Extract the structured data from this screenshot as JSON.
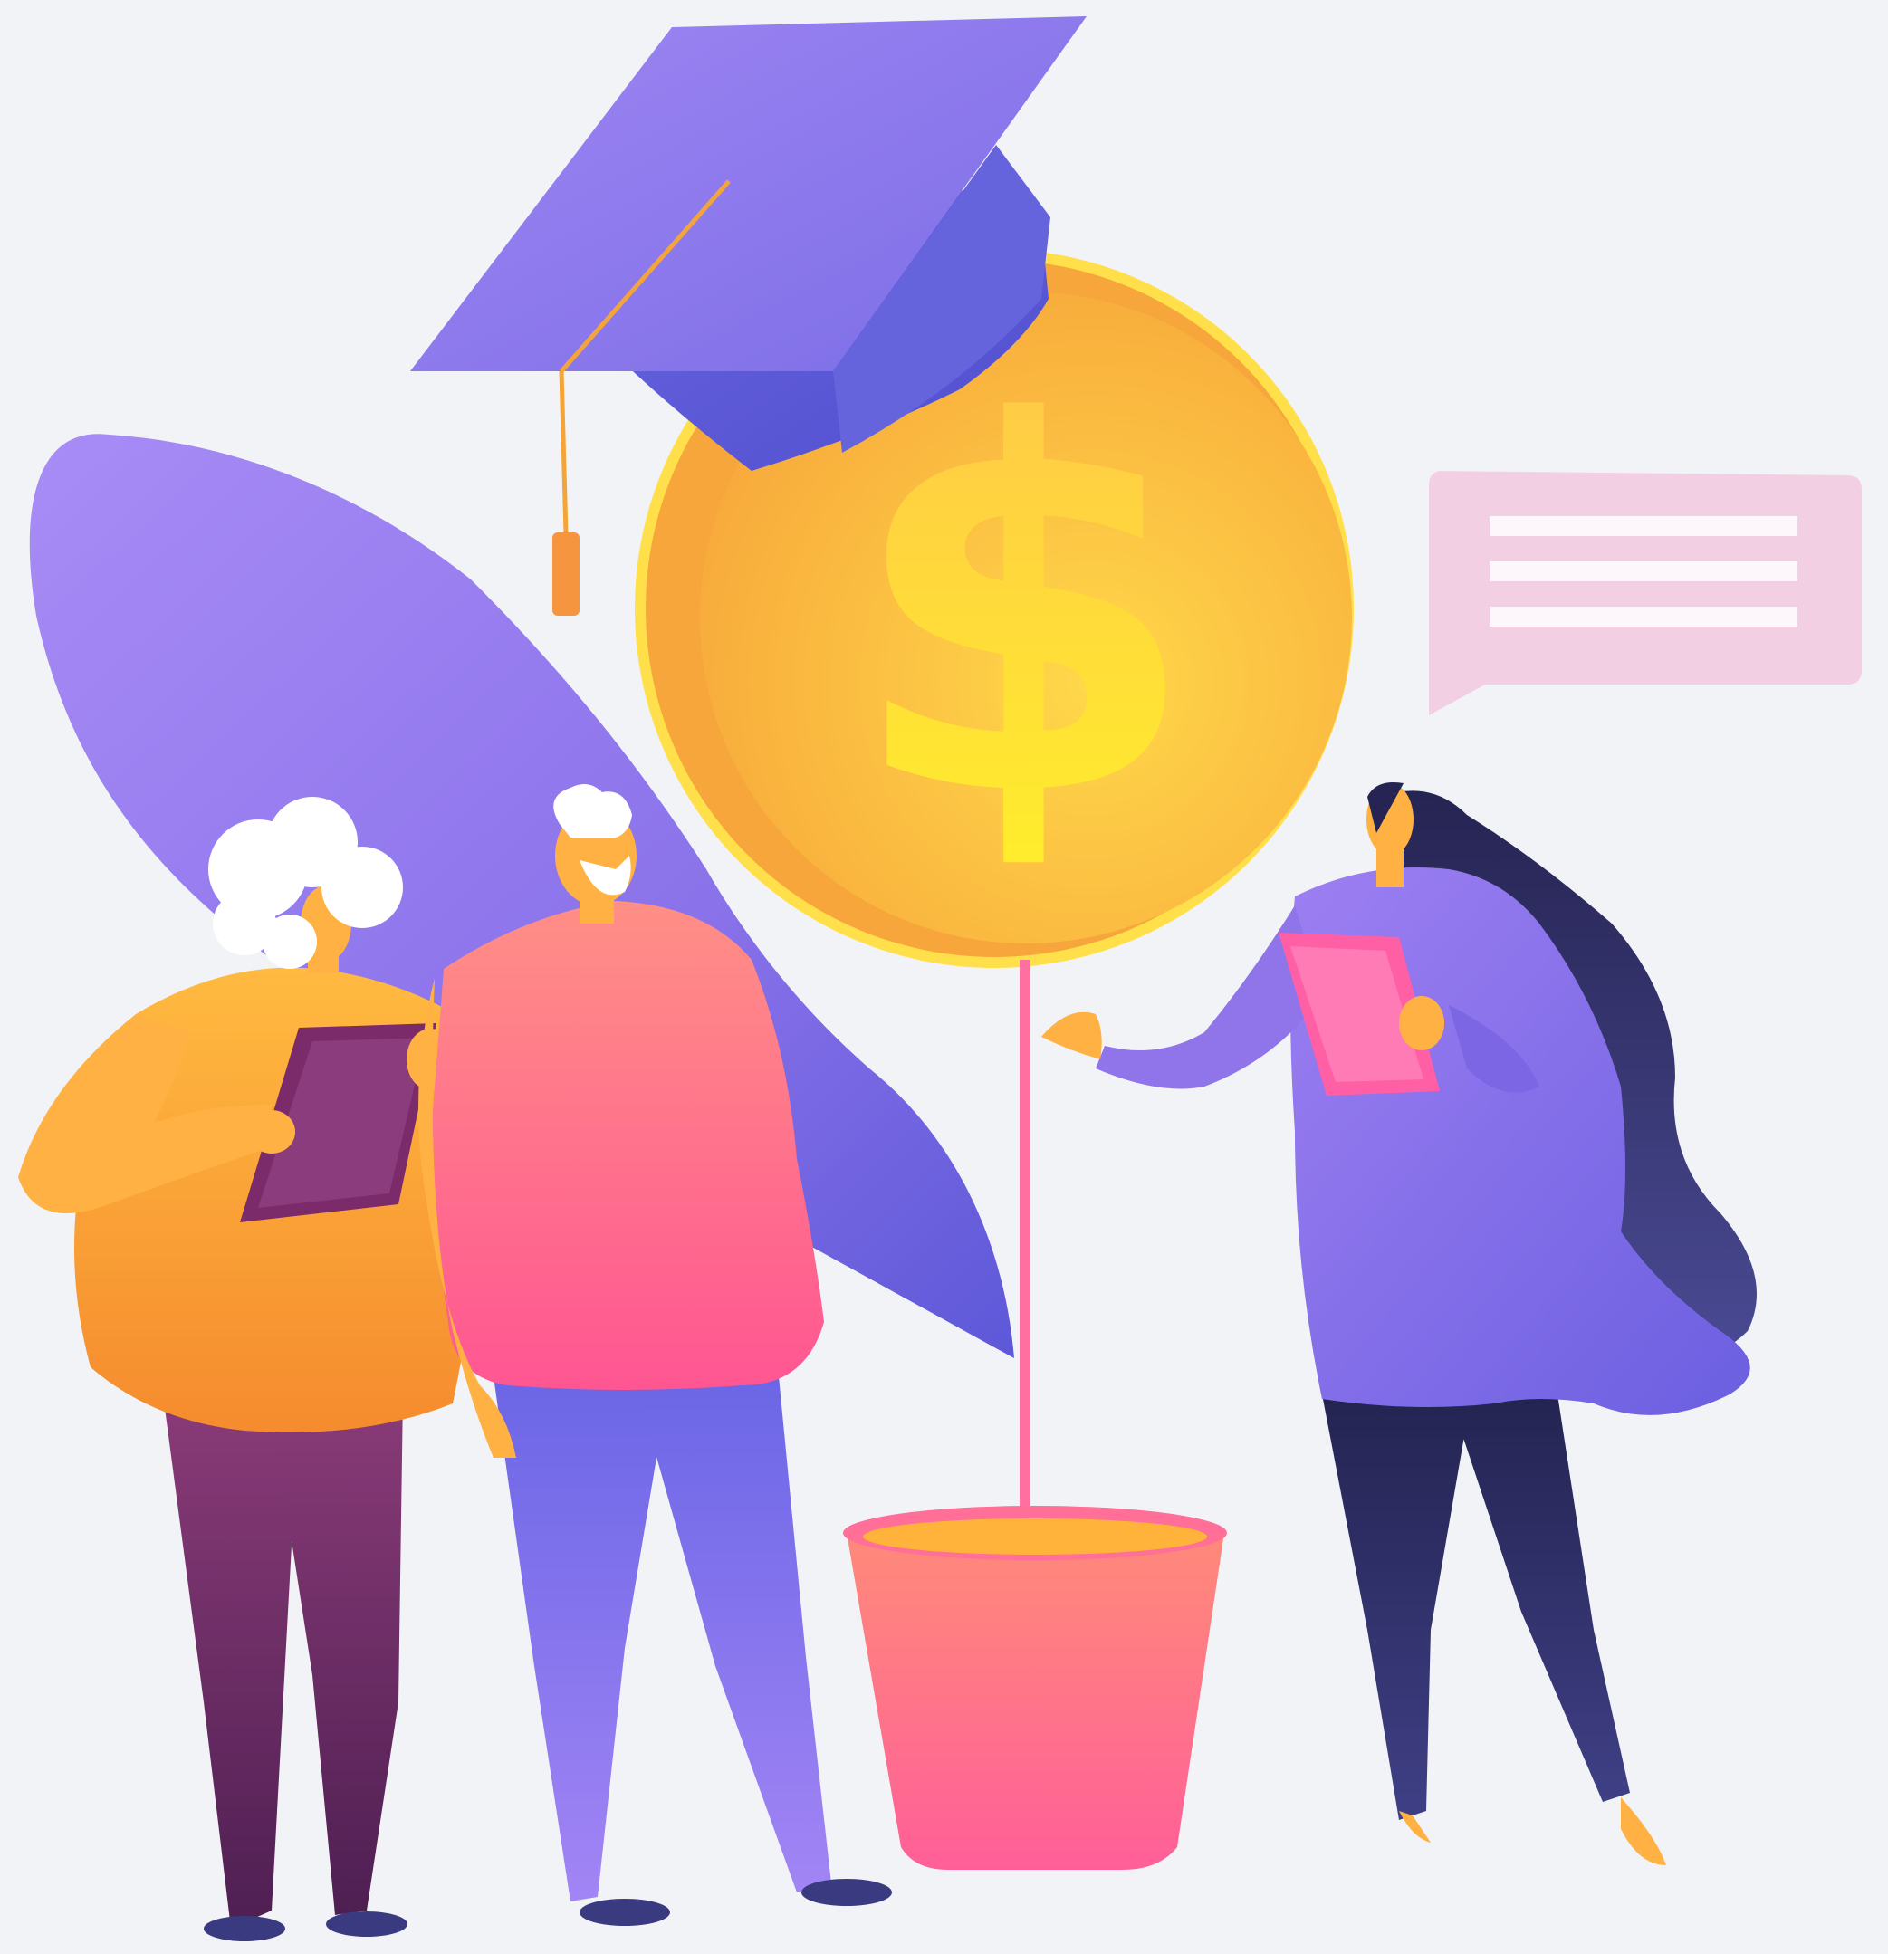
{
  "illustration": {
    "coin_symbol": "$",
    "palette": {
      "background": "#f2f3f6",
      "purple": "#8f74ea",
      "deep_purple": "#5f55d6",
      "coin_gold": "#fbb73b",
      "coin_rim": "#ffd94a",
      "pink": "#ff6c8e",
      "orange": "#fcae3c",
      "speech_bubble": "#f3cfe3"
    },
    "icons": [
      "graduation-cap-icon",
      "dollar-coin-icon",
      "speech-bubble-icon",
      "plant-pot-icon"
    ]
  }
}
